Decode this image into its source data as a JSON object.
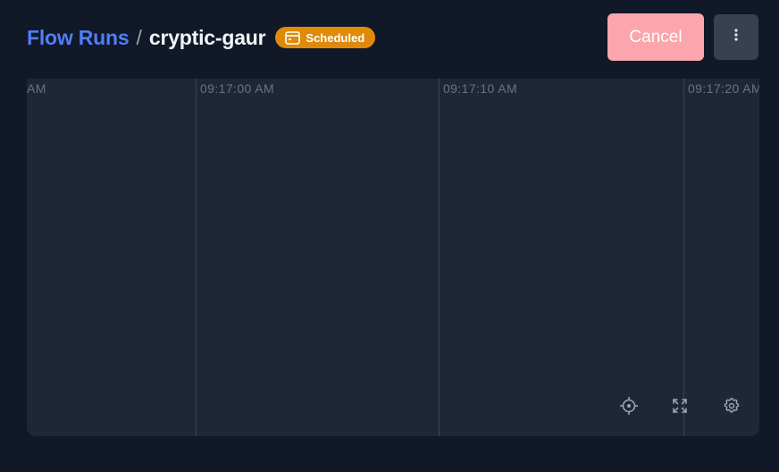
{
  "breadcrumb": {
    "parent": "Flow Runs",
    "separator": "/",
    "current": "cryptic-gaur"
  },
  "state_badge": {
    "label": "Scheduled",
    "icon": "calendar-icon",
    "color": "#e08a0a"
  },
  "actions": {
    "cancel_label": "Cancel",
    "cancel_color": "#fca5ad",
    "menu_icon": "vertical-ellipsis-icon"
  },
  "timeline": {
    "ticks": [
      {
        "label": "AM"
      },
      {
        "label": "09:17:00 AM"
      },
      {
        "label": "09:17:10 AM"
      },
      {
        "label": "09:17:20 AM"
      }
    ],
    "controls": [
      {
        "name": "recenter",
        "icon": "crosshair-icon"
      },
      {
        "name": "fullscreen",
        "icon": "expand-icon"
      },
      {
        "name": "settings",
        "icon": "gear-icon"
      }
    ]
  }
}
